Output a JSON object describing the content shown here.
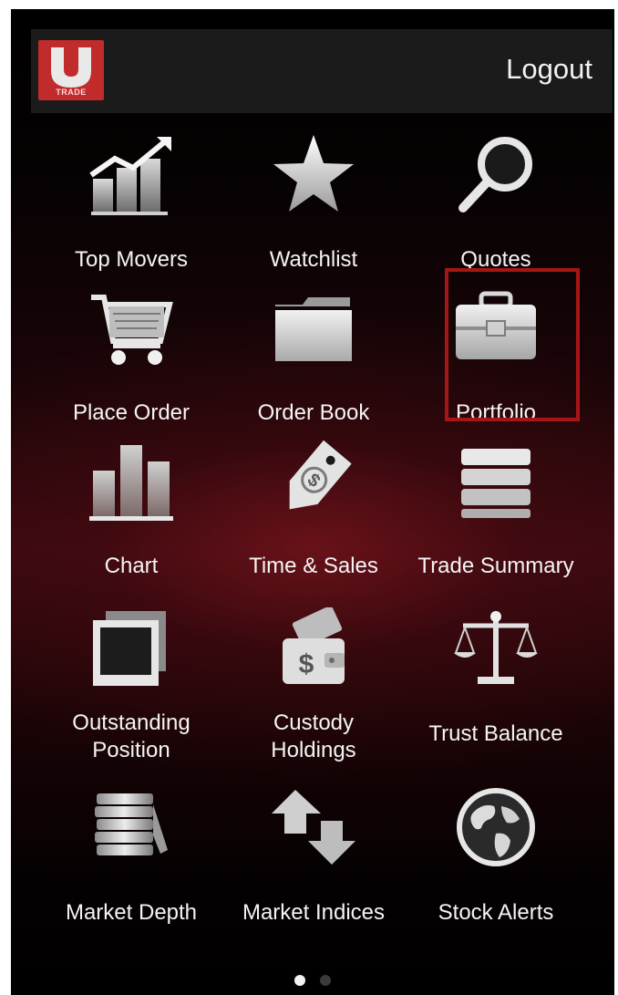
{
  "header": {
    "logo_letter": "U",
    "logo_text": "TRADE",
    "logout_label": "Logout"
  },
  "menu": {
    "items": [
      {
        "label": "Top Movers",
        "icon": "trend-chart-icon"
      },
      {
        "label": "Watchlist",
        "icon": "star-icon"
      },
      {
        "label": "Quotes",
        "icon": "magnifier-icon"
      },
      {
        "label": "Place Order",
        "icon": "cart-icon"
      },
      {
        "label": "Order Book",
        "icon": "folder-icon"
      },
      {
        "label": "Portfolio",
        "icon": "briefcase-icon"
      },
      {
        "label": "Chart",
        "icon": "bar-chart-icon"
      },
      {
        "label": "Time & Sales",
        "icon": "price-tag-icon"
      },
      {
        "label": "Trade Summary",
        "icon": "stack-icon"
      },
      {
        "label": "Outstanding\nPosition",
        "icon": "photo-stack-icon"
      },
      {
        "label": "Custody\nHoldings",
        "icon": "wallet-icon"
      },
      {
        "label": "Trust Balance",
        "icon": "scale-icon"
      },
      {
        "label": "Market Depth",
        "icon": "coin-stack-icon"
      },
      {
        "label": "Market Indices",
        "icon": "arrows-icon"
      },
      {
        "label": "Stock Alerts",
        "icon": "globe-icon"
      }
    ],
    "highlighted": "Portfolio"
  },
  "pager": {
    "pages": 2,
    "current": 1
  },
  "colors": {
    "highlight": "#a61616",
    "background": "#000000",
    "accent": "#c22b2b"
  }
}
